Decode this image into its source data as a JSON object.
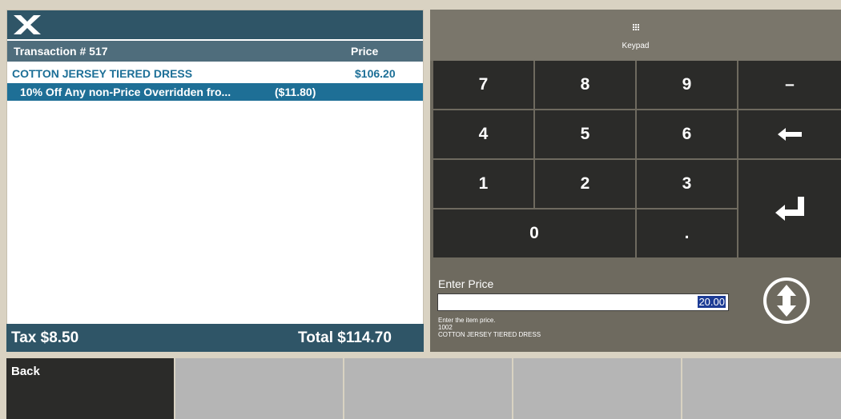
{
  "header": {
    "logo_icon": "x-logo-icon"
  },
  "transaction": {
    "title": "Transaction # 517",
    "price_header": "Price",
    "items": [
      {
        "description": "COTTON JERSEY TIERED DRESS",
        "amount": "$106.20",
        "selected": false
      },
      {
        "description": "10% Off Any non-Price Overridden fro...",
        "amount": "($11.80)",
        "selected": true
      }
    ],
    "tax_label": "Tax",
    "tax_value": "$8.50",
    "total_label": "Total",
    "total_value": "$114.70"
  },
  "keypad": {
    "tab_icon": "keypad-grid-icon",
    "tab_label": "Keypad",
    "keys": {
      "seven": "7",
      "eight": "8",
      "nine": "9",
      "minus": "–",
      "four": "4",
      "five": "5",
      "six": "6",
      "one": "1",
      "two": "2",
      "three": "3",
      "zero": "0",
      "dot": "."
    },
    "backspace_icon": "backspace-arrow-icon",
    "enter_icon": "enter-return-icon"
  },
  "entry": {
    "label": "Enter Price",
    "value": "20.00",
    "hint_line1": "Enter the item price.",
    "hint_line2": "1002",
    "hint_line3": "COTTON JERSEY TIERED DRESS",
    "scroll_icon": "up-down-arrow-circle-icon"
  },
  "function_bar": {
    "back_label": "Back"
  },
  "colors": {
    "header_teal": "#2f5567",
    "selected_row": "#1e6f96",
    "item_text": "#1c6f97",
    "key_dark": "#2b2b29",
    "panel_gray": "#6e6a5f",
    "function_gray": "#b5b5b5"
  }
}
